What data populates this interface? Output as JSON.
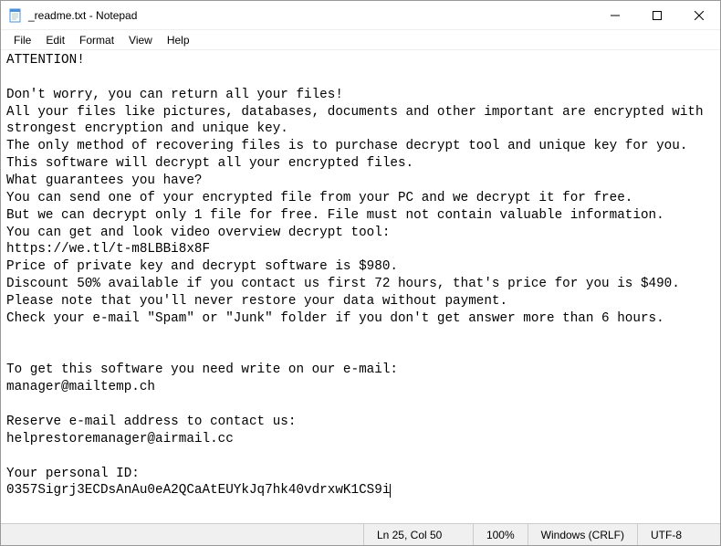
{
  "titlebar": {
    "title": "_readme.txt - Notepad"
  },
  "menubar": {
    "file": "File",
    "edit": "Edit",
    "format": "Format",
    "view": "View",
    "help": "Help"
  },
  "editor": {
    "content": "ATTENTION!\n\nDon't worry, you can return all your files!\nAll your files like pictures, databases, documents and other important are encrypted with strongest encryption and unique key.\nThe only method of recovering files is to purchase decrypt tool and unique key for you.\nThis software will decrypt all your encrypted files.\nWhat guarantees you have?\nYou can send one of your encrypted file from your PC and we decrypt it for free.\nBut we can decrypt only 1 file for free. File must not contain valuable information.\nYou can get and look video overview decrypt tool:\nhttps://we.tl/t-m8LBBi8x8F\nPrice of private key and decrypt software is $980.\nDiscount 50% available if you contact us first 72 hours, that's price for you is $490.\nPlease note that you'll never restore your data without payment.\nCheck your e-mail \"Spam\" or \"Junk\" folder if you don't get answer more than 6 hours.\n\n\nTo get this software you need write on our e-mail:\nmanager@mailtemp.ch\n\nReserve e-mail address to contact us:\nhelprestoremanager@airmail.cc\n\nYour personal ID:\n0357Sigrj3ECDsAnAu0eA2QCaAtEUYkJq7hk40vdrxwK1CS9i"
  },
  "statusbar": {
    "position": "Ln 25, Col 50",
    "zoom": "100%",
    "lineending": "Windows (CRLF)",
    "encoding": "UTF-8"
  }
}
